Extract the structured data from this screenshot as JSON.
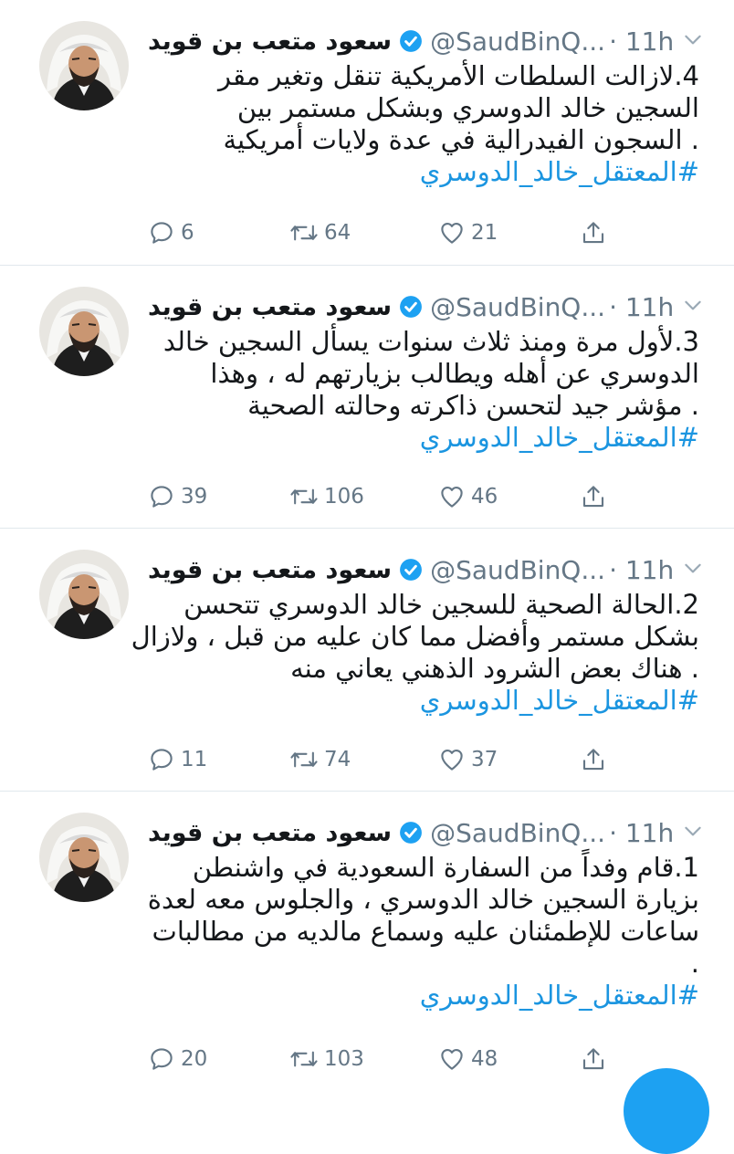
{
  "author": {
    "name": "سعود متعب بن قويد",
    "handle": "@SaudBinQ...",
    "time": "· 11h"
  },
  "icons": {
    "verified": "verified-badge-icon",
    "caret": "chevron-down-icon",
    "reply": "reply-icon",
    "retweet": "retweet-icon",
    "like": "heart-icon",
    "share": "share-icon"
  },
  "colors": {
    "accent": "#1da1f2",
    "hashtag": "#1b95e0",
    "muted": "#657786",
    "divider": "#e1e8ed"
  },
  "tweets": [
    {
      "lines": [
        "4.لازالت السلطات الأمريكية تنقل وتغير مقر",
        "السجين خالد الدوسري وبشكل مستمر بين",
        ". السجون الفيدرالية في عدة ولايات أمريكية"
      ],
      "hashtag": "#المعتقل_خالد_الدوسري",
      "replies": "6",
      "retweets": "64",
      "likes": "21"
    },
    {
      "lines": [
        "3.لأول مرة ومنذ ثلاث سنوات يسأل السجين خالد",
        "الدوسري عن أهله ويطالب بزيارتهم له ، وهذا",
        ". مؤشر جيد لتحسن ذاكرته وحالته الصحية"
      ],
      "hashtag": "#المعتقل_خالد_الدوسري",
      "replies": "39",
      "retweets": "106",
      "likes": "46"
    },
    {
      "lines": [
        "2.الحالة الصحية للسجين خالد الدوسري تتحسن",
        "بشكل مستمر وأفضل مما كان عليه من قبل ، ولازال",
        ". هناك بعض الشرود الذهني يعاني منه"
      ],
      "hashtag": "#المعتقل_خالد_الدوسري",
      "replies": "11",
      "retweets": "74",
      "likes": "37"
    },
    {
      "lines": [
        "1.قام وفداً من السفارة السعودية في واشنطن",
        "بزيارة السجين خالد الدوسري ، والجلوس معه لعدة",
        "ساعات للإطمئنان عليه وسماع مالديه من مطالبات",
        "."
      ],
      "hashtag": "#المعتقل_خالد_الدوسري",
      "replies": "20",
      "retweets": "103",
      "likes": "48"
    }
  ]
}
